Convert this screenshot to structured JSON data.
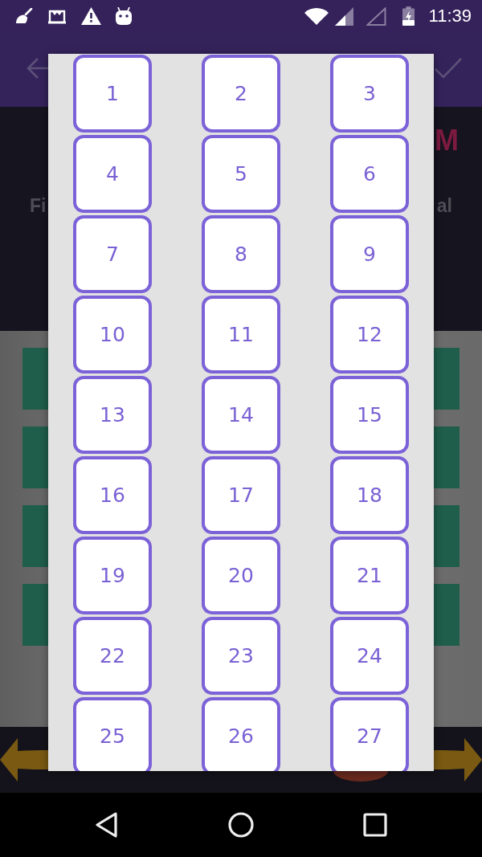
{
  "status_bar": {
    "time": "11:39"
  },
  "background_screen": {
    "heading_fragment": "M",
    "left_label_fragment": "Fi",
    "right_label_fragment": "al"
  },
  "number_dialog": {
    "numbers": [
      "1",
      "2",
      "3",
      "4",
      "5",
      "6",
      "7",
      "8",
      "9",
      "10",
      "11",
      "12",
      "13",
      "14",
      "15",
      "16",
      "17",
      "18",
      "19",
      "20",
      "21",
      "22",
      "23",
      "24",
      "25",
      "26",
      "27"
    ]
  }
}
